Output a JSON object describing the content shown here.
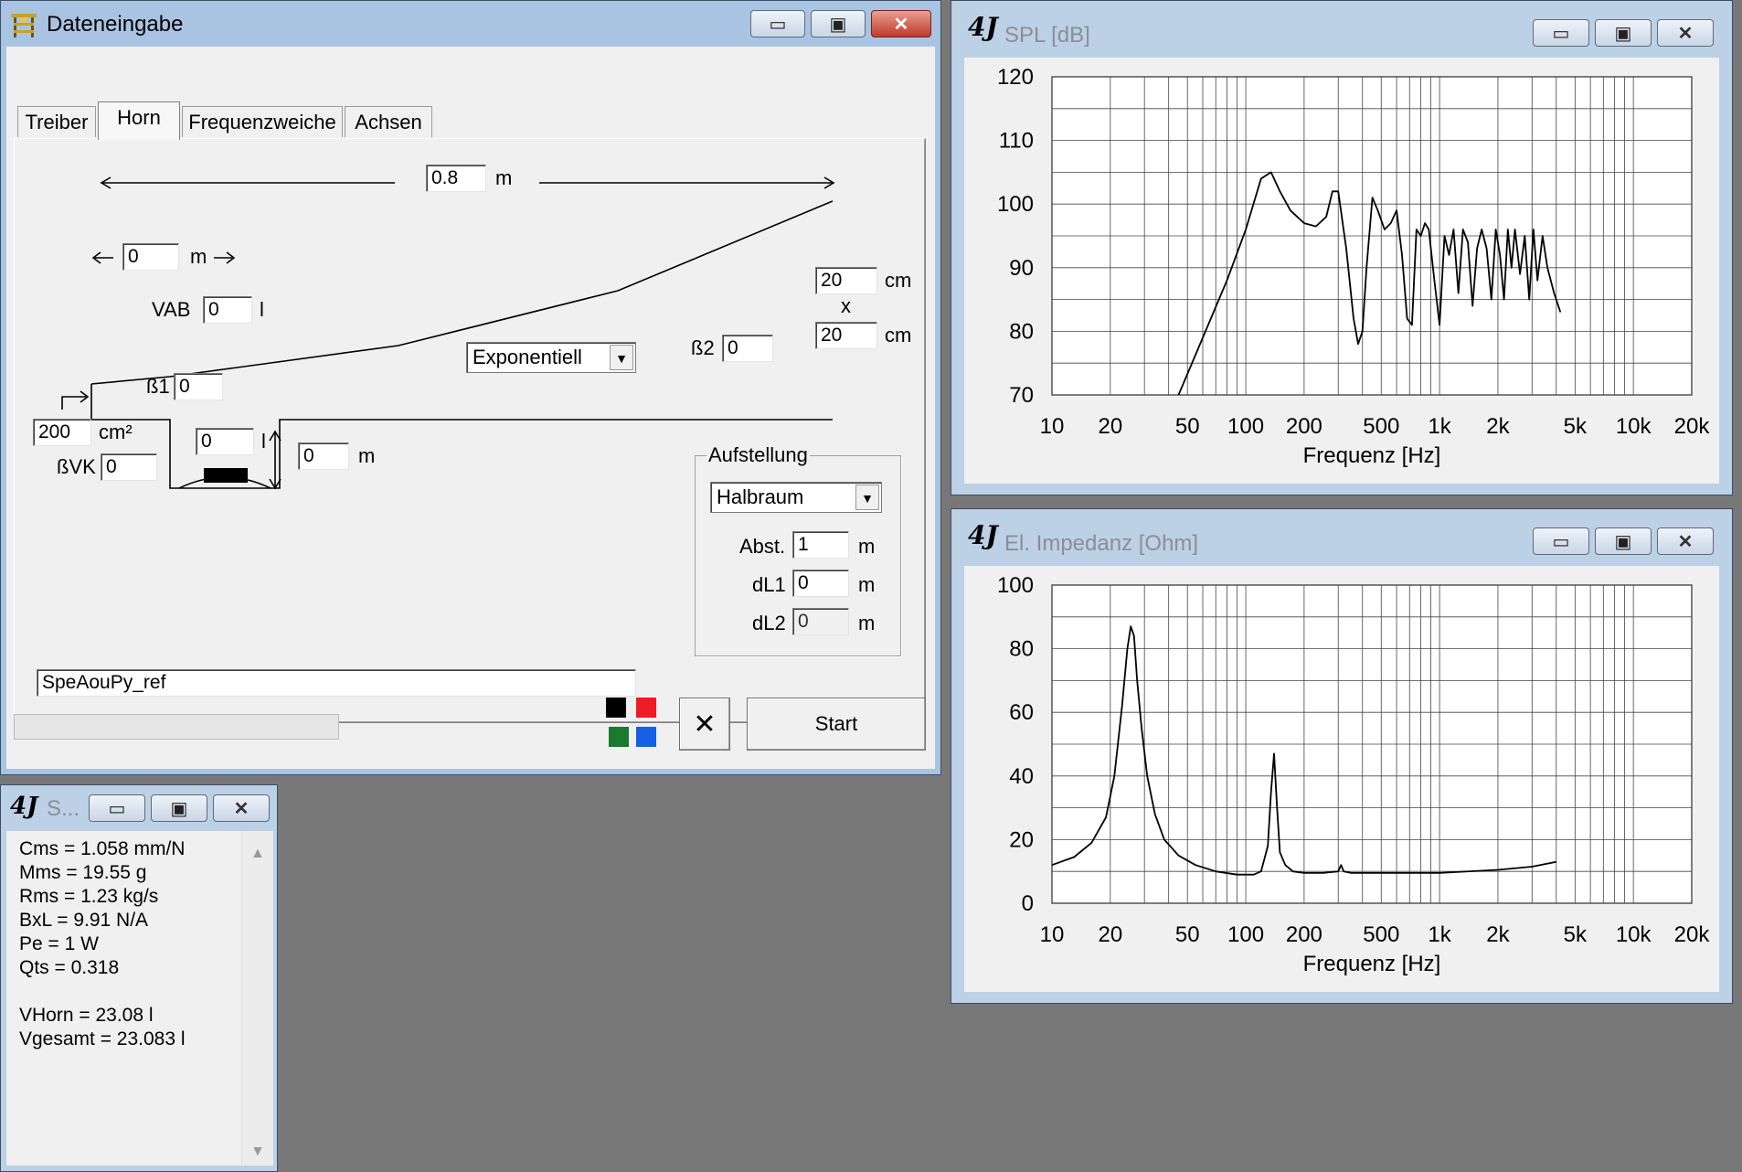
{
  "dateneingabe": {
    "title": "Dateneingabe",
    "tabs": [
      "Treiber",
      "Horn",
      "Frequenzweiche",
      "Achsen"
    ],
    "horn": {
      "length_value": "0.8",
      "length_unit": "m",
      "offset_value": "0",
      "offset_unit": "m",
      "vab_label": "VAB",
      "vab_value": "0",
      "vab_unit": "l",
      "mouth_w_value": "20",
      "mouth_w_unit": "cm",
      "mouth_x": "x",
      "mouth_h_value": "20",
      "mouth_h_unit": "cm",
      "beta2_label": "ß2",
      "beta2_value": "0",
      "flare_type": "Exponentiell",
      "beta1_label": "ß1",
      "beta1_value": "0",
      "throat_value": "200",
      "throat_unit": "cm²",
      "bvk_label": "ßVK",
      "bvk_value": "0",
      "chamber_value": "0",
      "chamber_unit": "l",
      "depth_value": "0",
      "depth_unit": "m",
      "aufstellung_label": "Aufstellung",
      "aufstellung_value": "Halbraum",
      "abst_label": "Abst.",
      "abst_value": "1",
      "abst_unit": "m",
      "dl1_label": "dL1",
      "dl1_value": "0",
      "dl1_unit": "m",
      "dl2_label": "dL2",
      "dl2_value": "0",
      "dl2_unit": "m",
      "name_value": "SpeAouPy_ref"
    },
    "colors": [
      "#000000",
      "#ee1c24",
      "#1a7a2e",
      "#1560e6"
    ],
    "start_label": "Start"
  },
  "stats": {
    "title": "S...",
    "lines": [
      "Cms = 1.058 mm/N",
      "Mms = 19.55 g",
      "Rms = 1.23 kg/s",
      "BxL = 9.91 N/A",
      "Pe = 1 W",
      "Qts = 0.318",
      "",
      "VHorn = 23.08 l",
      "Vgesamt = 23.083 l"
    ]
  },
  "spl_window": {
    "title": "SPL [dB]"
  },
  "imp_window": {
    "title": "El. Impedanz [Ohm]"
  },
  "chart_data": [
    {
      "type": "line",
      "xscale": "log",
      "xlabel": "Frequenz [Hz]",
      "xlim": [
        10,
        20000
      ],
      "xticks": [
        10,
        20,
        50,
        100,
        200,
        500,
        1000,
        2000,
        5000,
        10000,
        20000
      ],
      "xtick_labels": [
        "10",
        "20",
        "50",
        "100",
        "200",
        "500",
        "1k",
        "2k",
        "5k",
        "10k",
        "20k"
      ],
      "ylim": [
        70,
        120
      ],
      "yticks": [
        70,
        80,
        90,
        100,
        110,
        120
      ],
      "grid": true,
      "series": [
        {
          "x": [
            45,
            60,
            80,
            100,
            120,
            135,
            150,
            170,
            200,
            230,
            260,
            280,
            300,
            330,
            360,
            380,
            400,
            420,
            450,
            480,
            520,
            560,
            600,
            640,
            680,
            720,
            760,
            800,
            840,
            880,
            940,
            1000,
            1060,
            1120,
            1180,
            1250,
            1320,
            1400,
            1480,
            1560,
            1650,
            1750,
            1850,
            1950,
            2050,
            2150,
            2250,
            2350,
            2450,
            2600,
            2750,
            2900,
            3050,
            3200,
            3400,
            3600,
            3900,
            4200
          ],
          "y": [
            70,
            79,
            88,
            96,
            104,
            105,
            102,
            99,
            97,
            96.5,
            98,
            102,
            102,
            93,
            82,
            78,
            80,
            90,
            101,
            99,
            96,
            97,
            99,
            92,
            82,
            81,
            96,
            95,
            97,
            96,
            88,
            81,
            95,
            92,
            96,
            86,
            96,
            94,
            84,
            93,
            96,
            93,
            85,
            96,
            92,
            85,
            96,
            90,
            96,
            89,
            95,
            85,
            96,
            88,
            95,
            90,
            86,
            83
          ]
        }
      ]
    },
    {
      "type": "line",
      "xscale": "log",
      "xlabel": "Frequenz [Hz]",
      "xlim": [
        10,
        20000
      ],
      "xticks": [
        10,
        20,
        50,
        100,
        200,
        500,
        1000,
        2000,
        5000,
        10000,
        20000
      ],
      "xtick_labels": [
        "10",
        "20",
        "50",
        "100",
        "200",
        "500",
        "1k",
        "2k",
        "5k",
        "10k",
        "20k"
      ],
      "ylim": [
        0,
        100
      ],
      "yticks": [
        0,
        20,
        40,
        60,
        80,
        100
      ],
      "grid": true,
      "series": [
        {
          "x": [
            10,
            13,
            16,
            19,
            21,
            23,
            24.5,
            25.5,
            26.5,
            27.5,
            29,
            31,
            34,
            38,
            45,
            55,
            70,
            90,
            110,
            120,
            130,
            135,
            140,
            145,
            150,
            160,
            175,
            200,
            250,
            300,
            310,
            320,
            350,
            500,
            1000,
            2000,
            3000,
            4000
          ],
          "y": [
            12,
            14.5,
            19,
            27,
            40,
            62,
            80,
            87,
            84,
            70,
            55,
            40,
            28,
            20,
            15,
            12,
            10,
            9,
            9,
            10,
            18,
            35,
            47,
            30,
            16,
            12,
            10,
            9.5,
            9.5,
            10,
            12,
            10,
            9.5,
            9.5,
            9.5,
            10.5,
            11.5,
            13
          ]
        }
      ]
    }
  ]
}
